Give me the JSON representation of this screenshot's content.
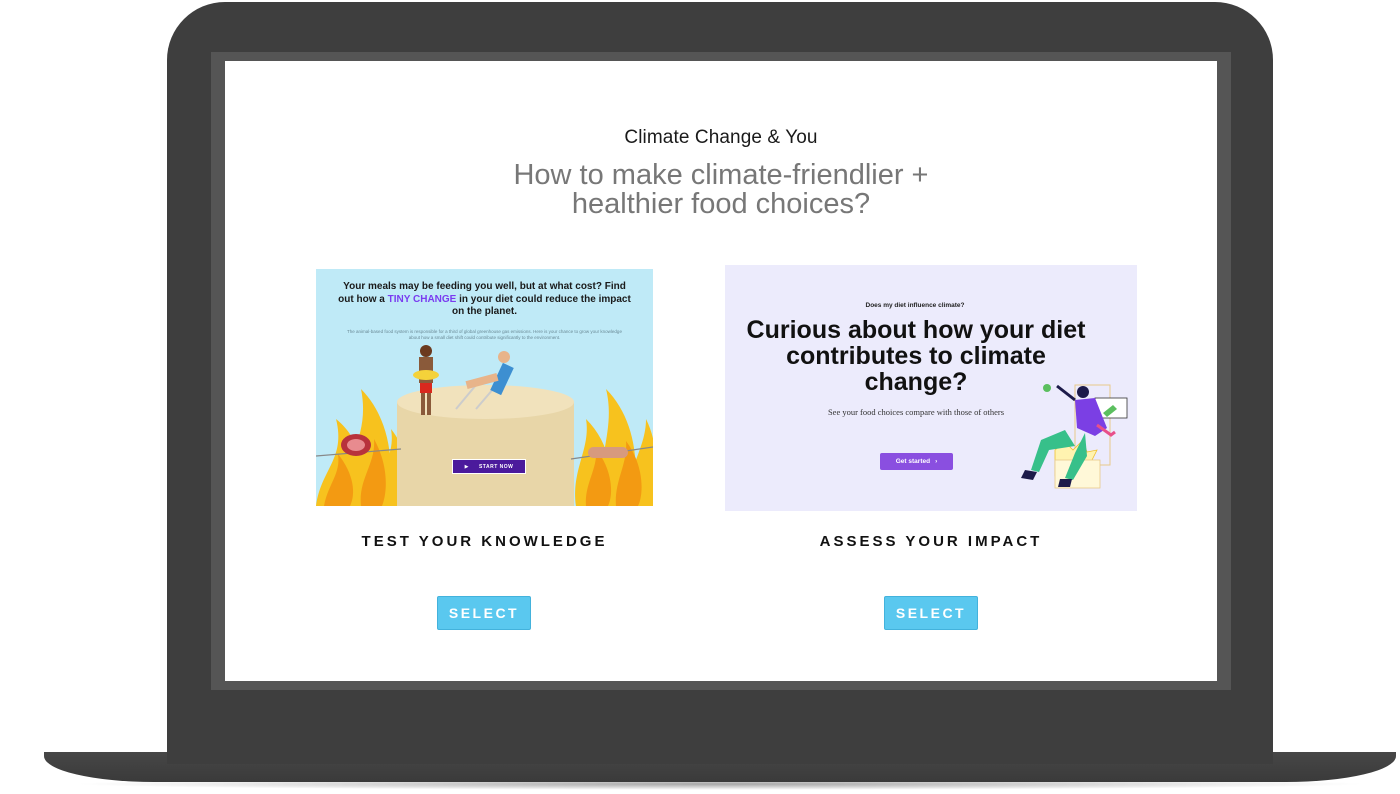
{
  "page": {
    "title": "Climate Change & You",
    "subtitle": "How to make climate-friendlier + healthier food choices?"
  },
  "cards": [
    {
      "image": {
        "headline_before": "Your meals may be feeding you well, but at what cost? Find out how a ",
        "headline_highlight": "TINY CHANGE",
        "headline_after": " in your diet could reduce the impact on the planet.",
        "small_text": "The animal-based food system is responsible for a third of global greenhouse gas emissions. Here is your chance to grow your knowledge about how a small diet shift could contribute significantly to the environment.",
        "button_label": "START NOW",
        "highlight_color": "#7a3cf0",
        "background_color": "#bfeaf7"
      },
      "label": "TEST YOUR KNOWLEDGE",
      "select_label": "SELECT"
    },
    {
      "image": {
        "kicker": "Does my diet influence climate?",
        "headline": "Curious about how your diet contributes to climate change?",
        "subtext": "See your food choices compare with those of others",
        "button_label": "Get started",
        "button_color": "#8a4fe0",
        "background_color": "#ecebfc"
      },
      "label": "ASSESS YOUR IMPACT",
      "select_label": "SELECT"
    }
  ],
  "colors": {
    "select_button": "#5ac8ef",
    "laptop_frame": "#3e3e3e"
  }
}
